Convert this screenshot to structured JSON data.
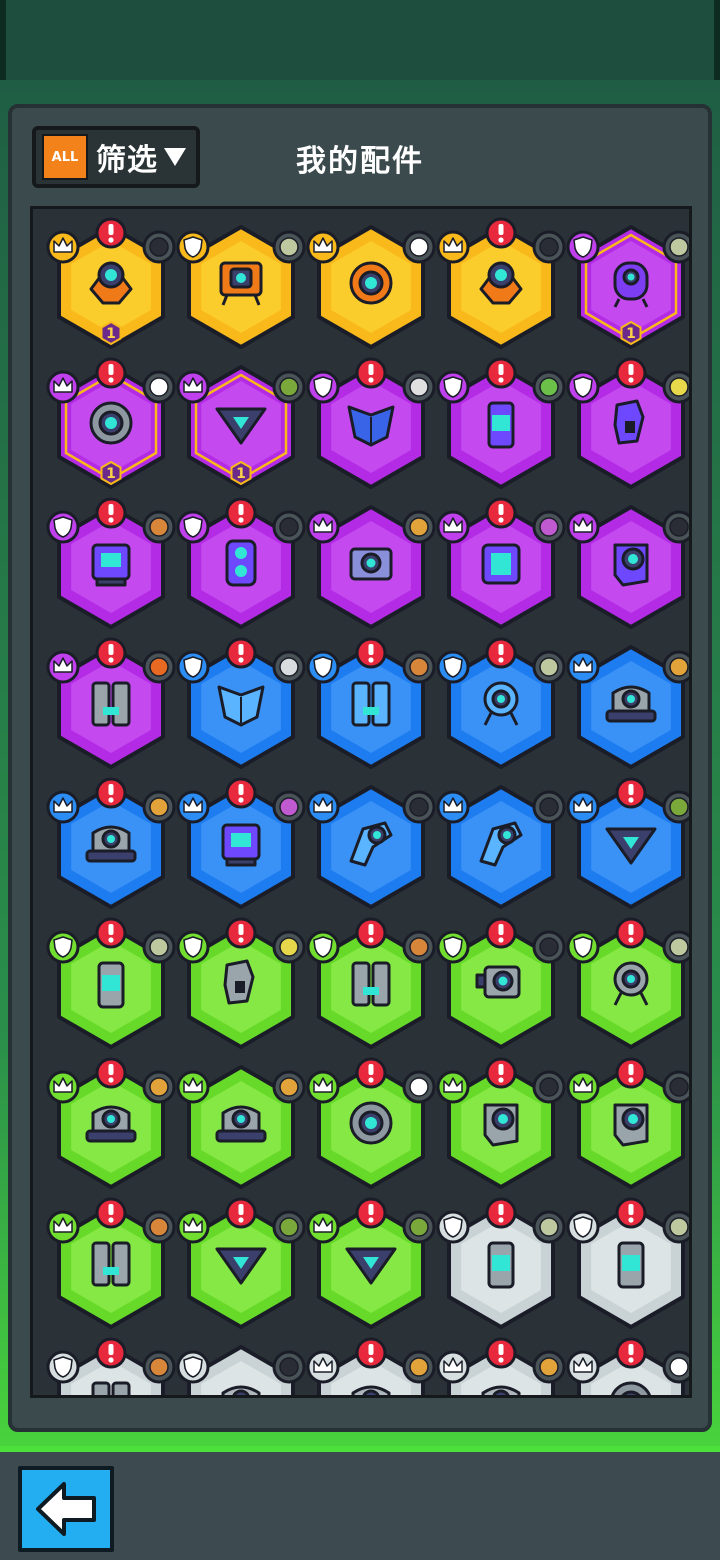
{
  "header": {
    "filter_badge": "ALL",
    "filter_label": "筛选",
    "title": "我的配件"
  },
  "palette": {
    "gold": "#f9b91a",
    "purple": "#b42be6",
    "blue": "#1d7cf0",
    "green": "#67d928",
    "silver": "#c9d3d6",
    "alert": "#e8293d",
    "accent_green": "#4ce03a",
    "back_button": "#23aef2"
  },
  "parts": [
    {
      "rarity": "gold",
      "badge": "crown",
      "alert": true,
      "slot": "dark-gun",
      "icon": "drone-core",
      "level": "1"
    },
    {
      "rarity": "gold",
      "badge": "shield",
      "alert": false,
      "slot": "spiky-ball",
      "icon": "walker-box"
    },
    {
      "rarity": "gold",
      "badge": "crown",
      "alert": false,
      "slot": "soccer-ball",
      "icon": "ring-core"
    },
    {
      "rarity": "gold",
      "badge": "crown",
      "alert": true,
      "slot": "dark-gun",
      "icon": "drone-core"
    },
    {
      "rarity": "purple",
      "badge": "shield",
      "alert": false,
      "slot": "spiky-ball",
      "icon": "capsule-bot",
      "level": "1"
    },
    {
      "rarity": "purple",
      "badge": "crown",
      "alert": true,
      "slot": "soccer-ball",
      "icon": "ring-core",
      "level": "1"
    },
    {
      "rarity": "purple",
      "badge": "crown",
      "alert": false,
      "slot": "bottle",
      "icon": "triangle-core",
      "level": "1"
    },
    {
      "rarity": "purple",
      "badge": "shield",
      "alert": true,
      "slot": "rocket",
      "icon": "chest-armor"
    },
    {
      "rarity": "purple",
      "badge": "shield",
      "alert": true,
      "slot": "green-ball",
      "icon": "cylinder"
    },
    {
      "rarity": "purple",
      "badge": "shield",
      "alert": true,
      "slot": "radiation",
      "icon": "arm-plate"
    },
    {
      "rarity": "purple",
      "badge": "shield",
      "alert": true,
      "slot": "brick",
      "icon": "monitor-bot"
    },
    {
      "rarity": "purple",
      "badge": "shield",
      "alert": true,
      "slot": "dark-dome",
      "icon": "speaker"
    },
    {
      "rarity": "purple",
      "badge": "crown",
      "alert": false,
      "slot": "drill",
      "icon": "screen-box"
    },
    {
      "rarity": "purple",
      "badge": "crown",
      "alert": true,
      "slot": "tower",
      "icon": "battery-pack"
    },
    {
      "rarity": "purple",
      "badge": "crown",
      "alert": false,
      "slot": "dark-gun",
      "icon": "cannon-lens"
    },
    {
      "rarity": "purple",
      "badge": "crown",
      "alert": true,
      "slot": "orange-box",
      "icon": "twin-legs"
    },
    {
      "rarity": "blue",
      "badge": "shield",
      "alert": true,
      "slot": "feather",
      "icon": "chest-armor"
    },
    {
      "rarity": "blue",
      "badge": "shield",
      "alert": true,
      "slot": "brick",
      "icon": "twin-legs"
    },
    {
      "rarity": "blue",
      "badge": "shield",
      "alert": true,
      "slot": "spiky-ball",
      "icon": "ring-walker"
    },
    {
      "rarity": "blue",
      "badge": "crown",
      "alert": false,
      "slot": "drill",
      "icon": "dome-base"
    },
    {
      "rarity": "blue",
      "badge": "crown",
      "alert": true,
      "slot": "drill",
      "icon": "dome-base"
    },
    {
      "rarity": "blue",
      "badge": "crown",
      "alert": true,
      "slot": "tower",
      "icon": "monitor-bot"
    },
    {
      "rarity": "blue",
      "badge": "crown",
      "alert": false,
      "slot": "dark-gun",
      "icon": "blaster"
    },
    {
      "rarity": "blue",
      "badge": "crown",
      "alert": false,
      "slot": "dark-gun",
      "icon": "blaster"
    },
    {
      "rarity": "blue",
      "badge": "crown",
      "alert": true,
      "slot": "bottle",
      "icon": "triangle-core"
    },
    {
      "rarity": "green",
      "badge": "shield",
      "alert": true,
      "slot": "spiky-ball",
      "icon": "cylinder"
    },
    {
      "rarity": "green",
      "badge": "shield",
      "alert": true,
      "slot": "radiation",
      "icon": "arm-plate"
    },
    {
      "rarity": "green",
      "badge": "shield",
      "alert": true,
      "slot": "brick",
      "icon": "twin-legs"
    },
    {
      "rarity": "green",
      "badge": "shield",
      "alert": true,
      "slot": "dark-dome",
      "icon": "camera-box"
    },
    {
      "rarity": "green",
      "badge": "shield",
      "alert": true,
      "slot": "spiky-ball",
      "icon": "ring-walker"
    },
    {
      "rarity": "green",
      "badge": "crown",
      "alert": true,
      "slot": "drill",
      "icon": "dome-base"
    },
    {
      "rarity": "green",
      "badge": "crown",
      "alert": false,
      "slot": "drill",
      "icon": "dome-base"
    },
    {
      "rarity": "green",
      "badge": "crown",
      "alert": true,
      "slot": "soccer-ball",
      "icon": "ring-core"
    },
    {
      "rarity": "green",
      "badge": "crown",
      "alert": true,
      "slot": "dark-gun",
      "icon": "cannon-lens"
    },
    {
      "rarity": "green",
      "badge": "crown",
      "alert": true,
      "slot": "dark-gun",
      "icon": "cannon-lens"
    },
    {
      "rarity": "green",
      "badge": "crown",
      "alert": true,
      "slot": "brick",
      "icon": "twin-legs"
    },
    {
      "rarity": "green",
      "badge": "crown",
      "alert": true,
      "slot": "bottle",
      "icon": "triangle-core"
    },
    {
      "rarity": "green",
      "badge": "crown",
      "alert": true,
      "slot": "bottle",
      "icon": "triangle-core"
    },
    {
      "rarity": "silver",
      "badge": "shield",
      "alert": true,
      "slot": "spiky-ball",
      "icon": "cylinder"
    },
    {
      "rarity": "silver",
      "badge": "shield",
      "alert": true,
      "slot": "spiky-ball",
      "icon": "cylinder"
    },
    {
      "rarity": "silver",
      "badge": "shield",
      "alert": true,
      "slot": "brick",
      "icon": "twin-legs"
    },
    {
      "rarity": "silver",
      "badge": "shield",
      "alert": false,
      "slot": "dark-dome",
      "icon": "dome-base"
    },
    {
      "rarity": "silver",
      "badge": "crown",
      "alert": true,
      "slot": "drill",
      "icon": "dome-base"
    },
    {
      "rarity": "silver",
      "badge": "crown",
      "alert": true,
      "slot": "drill",
      "icon": "dome-base"
    },
    {
      "rarity": "silver",
      "badge": "crown",
      "alert": true,
      "slot": "soccer-ball",
      "icon": "ring-core"
    }
  ],
  "footer": {
    "back_icon": "left-arrow-icon"
  }
}
